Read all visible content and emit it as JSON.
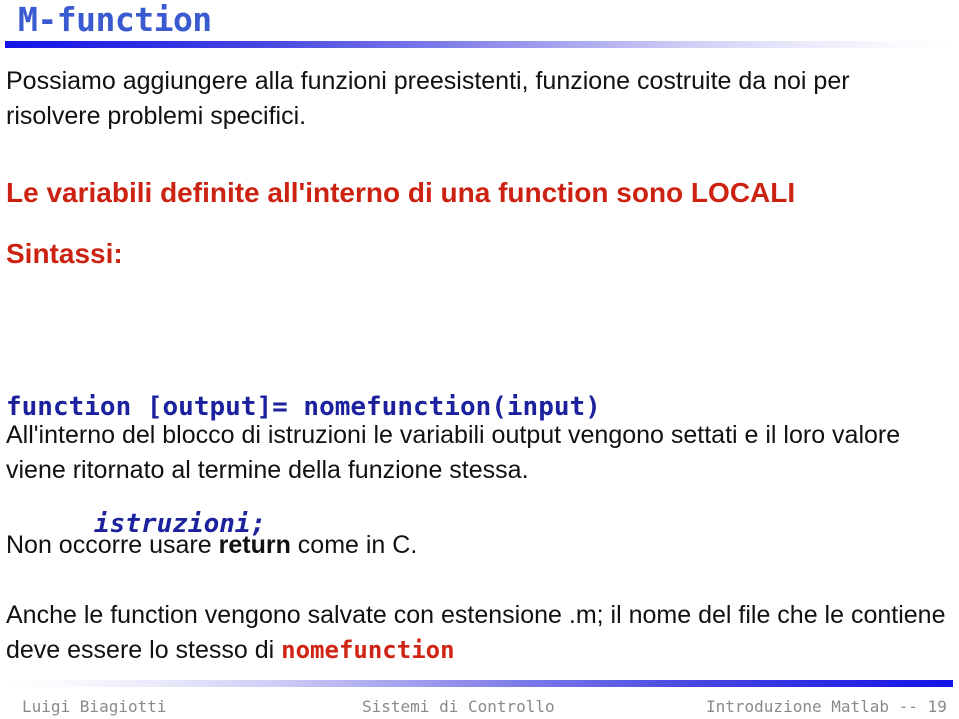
{
  "slide": {
    "title": "M-function",
    "title_color": "#3a5ad0",
    "accent_red": "#cc2211",
    "code_blue": "#1c219e",
    "rule_blue": "#1414e6",
    "background": "#ffffff"
  },
  "body": {
    "intro": "Possiamo aggiungere alla funzioni preesistenti, funzione costruite da noi per risolvere problemi specifici.",
    "locals_heading": "Le variabili definite all'interno di una function sono LOCALI",
    "sintassi_heading": "Sintassi:",
    "code_line_1": "function [output]= nomefunction(input)",
    "code_line_2": "istruzioni;",
    "blocco": "All'interno del blocco di istruzioni le variabili output vengono settati e il loro valore viene ritornato al termine della funzione stessa.",
    "return_prefix": "Non occorre usare ",
    "return_keyword": "return",
    "return_suffix": " come in C.",
    "estensione_prefix": "Anche le function vengono salvate con estensione .m; il nome del file che le contiene deve essere lo stesso di ",
    "estensione_keyword": "nomefunction"
  },
  "footer": {
    "author": "Luigi Biagiotti",
    "course": "Sistemi di Controllo",
    "section": "Introduzione Matlab -- 19"
  }
}
